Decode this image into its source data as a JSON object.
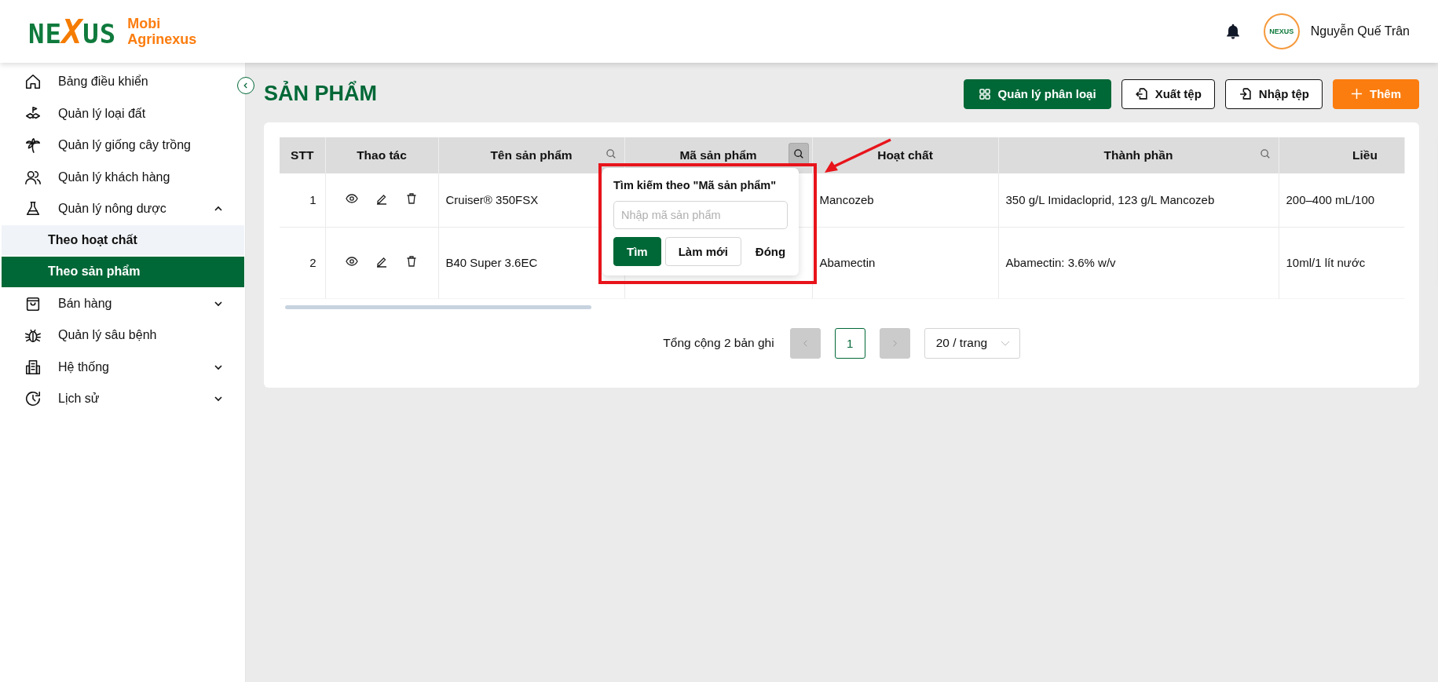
{
  "logo": {
    "wordmark": "NEXUS",
    "brand": [
      "Mobi",
      "Agrinexus"
    ]
  },
  "user": {
    "avatar_logo": "NEXUS",
    "name": "Nguyễn Quế Trân"
  },
  "sidebar": {
    "items": [
      {
        "kind": "link",
        "label": "Bảng điều khiển"
      },
      {
        "kind": "link",
        "label": "Quản lý loại đất"
      },
      {
        "kind": "link",
        "label": "Quản lý giống cây trồng"
      },
      {
        "kind": "link",
        "label": "Quản lý khách hàng"
      },
      {
        "kind": "group",
        "label": "Quản lý nông dược",
        "expanded": true,
        "children": [
          {
            "label": "Theo hoạt chất",
            "selected": false,
            "hovered": true
          },
          {
            "label": "Theo sản phẩm",
            "selected": true,
            "hovered": false
          }
        ]
      },
      {
        "kind": "group",
        "label": "Bán hàng",
        "expanded": false
      },
      {
        "kind": "link",
        "label": "Quản lý sâu bệnh"
      },
      {
        "kind": "group",
        "label": "Hệ thống",
        "expanded": false
      },
      {
        "kind": "group",
        "label": "Lịch sử",
        "expanded": false
      }
    ]
  },
  "page": {
    "title": "SẢN PHẨM",
    "actions": [
      {
        "label": "Quản lý phân loại",
        "kind": "primary"
      },
      {
        "label": "Xuất tệp",
        "kind": "outline"
      },
      {
        "label": "Nhập tệp",
        "kind": "outline"
      },
      {
        "label": "Thêm",
        "kind": "accent"
      }
    ]
  },
  "table": {
    "columns": [
      {
        "label": "STT",
        "searchable": false,
        "search_open": false
      },
      {
        "label": "Thao tác",
        "searchable": false,
        "search_open": false
      },
      {
        "label": "Tên sản phẩm",
        "searchable": true,
        "search_open": false
      },
      {
        "label": "Mã sản phẩm",
        "searchable": true,
        "search_open": true
      },
      {
        "label": "Hoạt chất",
        "searchable": false,
        "search_open": false
      },
      {
        "label": "Thành phần",
        "searchable": true,
        "search_open": false
      },
      {
        "label": "Liều"
      }
    ],
    "rows": [
      {
        "stt": "1",
        "name": "Cruiser® 350FSX",
        "active_ingredient": "Mancozeb",
        "composition": "350 g/L Imidacloprid, 123 g/L Mancozeb",
        "dosage": "200–400 mL/100"
      },
      {
        "stt": "2",
        "name": "B40 Super 3.6EC",
        "active_ingredient": "Abamectin",
        "composition": "Abamectin: 3.6% w/v",
        "dosage": "10ml/1 lít nước"
      }
    ]
  },
  "search_popup": {
    "title": "Tìm kiếm theo \"Mã sản phẩm\"",
    "placeholder": "Nhập mã sản phẩm",
    "buttons": [
      {
        "label": "Tìm",
        "kind": "primary"
      },
      {
        "label": "Làm mới",
        "kind": "outline"
      },
      {
        "label": "Đóng",
        "kind": "text"
      }
    ]
  },
  "pagination": {
    "total": "Tổng cộng 2 bản ghi",
    "prev_disabled": true,
    "next_disabled": true,
    "pages": [
      {
        "label": "1",
        "selected": true
      }
    ],
    "page_size": "20 / trang"
  }
}
